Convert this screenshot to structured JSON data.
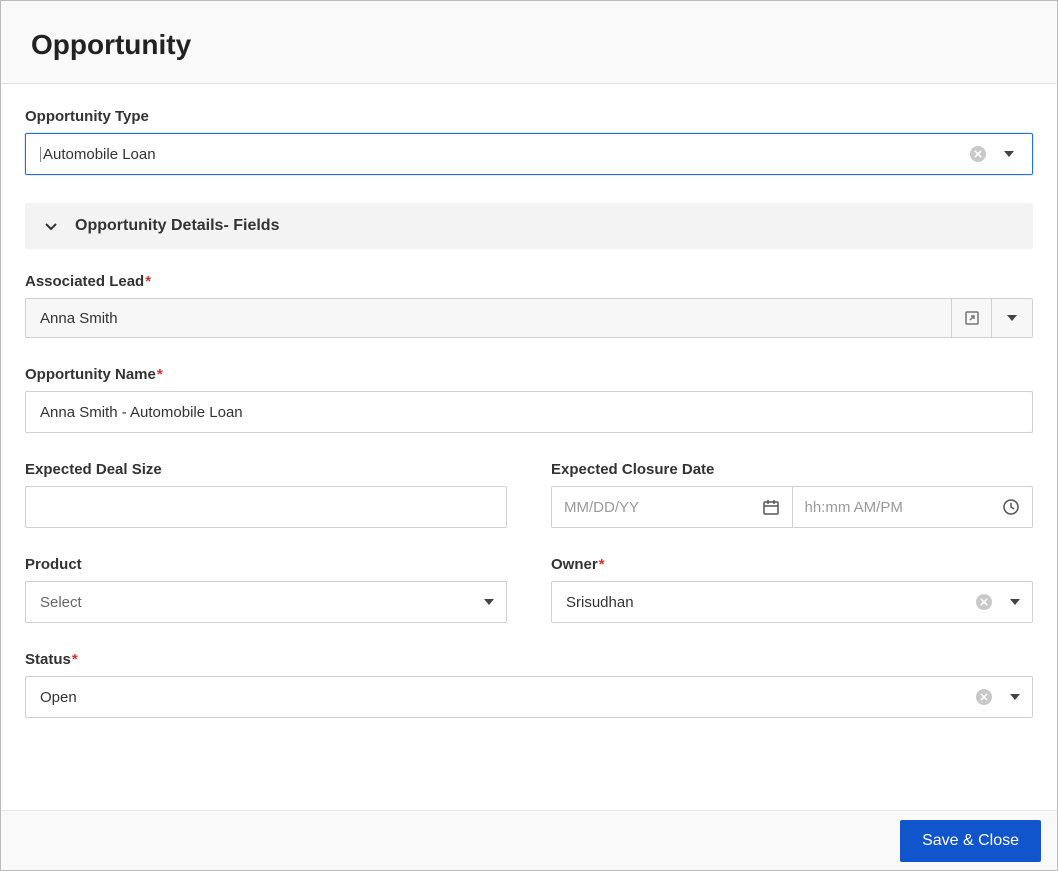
{
  "header": {
    "title": "Opportunity"
  },
  "opportunity_type": {
    "label": "Opportunity Type",
    "value": "Automobile Loan"
  },
  "section": {
    "title": "Opportunity Details- Fields",
    "expanded": true
  },
  "associated_lead": {
    "label": "Associated Lead",
    "required": true,
    "value": "Anna Smith"
  },
  "opportunity_name": {
    "label": "Opportunity Name",
    "required": true,
    "value": "Anna Smith - Automobile Loan"
  },
  "expected_deal_size": {
    "label": "Expected Deal Size",
    "value": ""
  },
  "expected_closure": {
    "label": "Expected Closure Date",
    "date_placeholder": "MM/DD/YY",
    "time_placeholder": "hh:mm AM/PM",
    "date_value": "",
    "time_value": ""
  },
  "product": {
    "label": "Product",
    "value": "Select"
  },
  "owner": {
    "label": "Owner",
    "required": true,
    "value": "Srisudhan"
  },
  "status": {
    "label": "Status",
    "required": true,
    "value": "Open"
  },
  "footer": {
    "save_close": "Save & Close"
  }
}
